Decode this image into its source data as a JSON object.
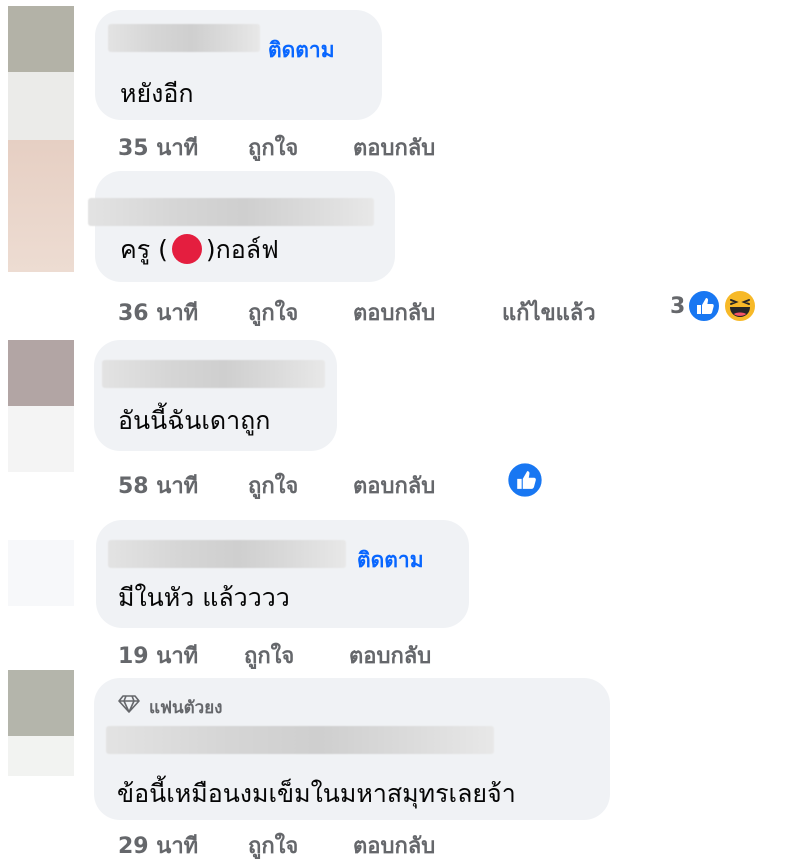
{
  "comments": [
    {
      "text": "หยังอีก",
      "follow": "ติดตาม",
      "time": "35 นาที",
      "like": "ถูกใจ",
      "reply": "ตอบกลับ"
    },
    {
      "text_before": "ครู (",
      "text_after": ")กอล์ฟ",
      "time": "36 นาที",
      "like": "ถูกใจ",
      "reply": "ตอบกลับ",
      "edited": "แก้ไขแล้ว",
      "reaction_count": "3",
      "reactions": [
        "like-icon",
        "haha-icon"
      ],
      "heart_icon": "heart-emoji"
    },
    {
      "text": "อันนี้ฉันเดาถูก",
      "time": "58 นาที",
      "like": "ถูกใจ",
      "reply": "ตอบกลับ",
      "reactions": [
        "like-icon"
      ]
    },
    {
      "text": "มีในหัว แล้วววว",
      "follow": "ติดตาม",
      "time": "19 นาที",
      "like": "ถูกใจ",
      "reply": "ตอบกลับ"
    },
    {
      "badge": "แฟนตัวยง",
      "badge_icon": "diamond-icon",
      "text": "ข้อนี้เหมือนงมเข็มในมหาสมุทรเลยจ้า",
      "time": "29 นาที",
      "like": "ถูกใจ",
      "reply": "ตอบกลับ"
    }
  ],
  "colors": {
    "bubble": "#f0f2f5",
    "follow": "#0866ff",
    "meta": "#65676b",
    "like": "#1877f2",
    "heart": "#e41e3f",
    "haha": "#f7b928"
  }
}
